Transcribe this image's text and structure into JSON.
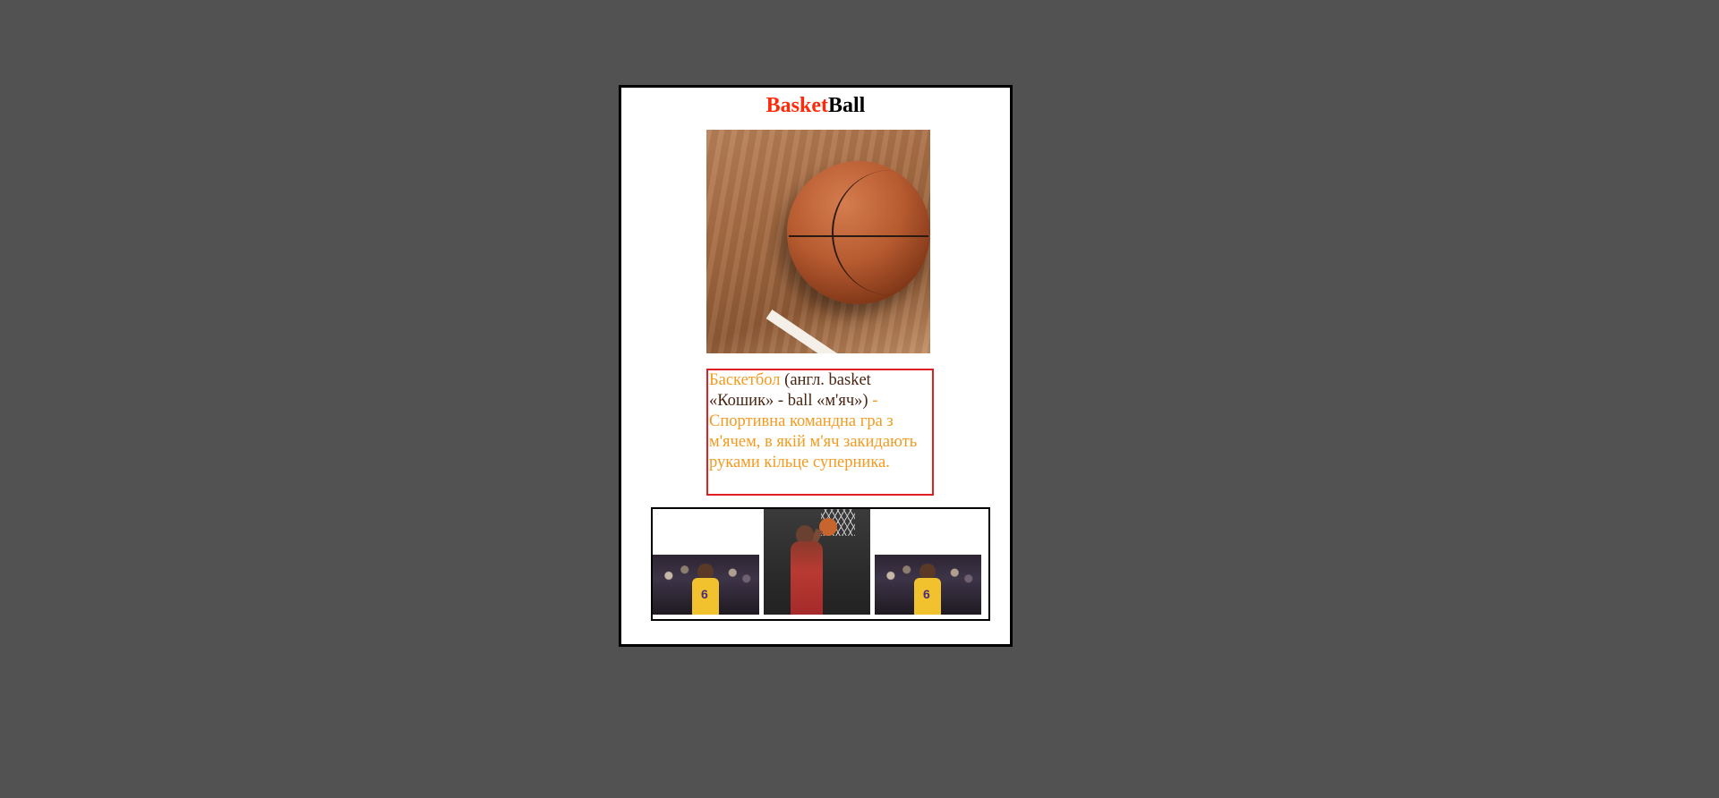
{
  "title": {
    "part1": "Basket",
    "part2": "Ball",
    "colors": {
      "part1": "#ff2a0a",
      "part2": "#000000"
    }
  },
  "main_image": {
    "icon": "basketball-photo"
  },
  "description": {
    "highlight_word": "Баскетбол",
    "etymology": "(англ. basket «Кошик» - ball «м'яч»)",
    "rest": " - Спортивна командна гра з м'ячем, в якій м'яч закидають руками кільце суперника.",
    "colors": {
      "text": "#f39a1f",
      "etymology": "#4a2512",
      "border": "#e02020"
    }
  },
  "gallery": {
    "images": [
      {
        "icon": "lakers-player-photo"
      },
      {
        "icon": "nuggets-player-dunk-photo"
      },
      {
        "icon": "lakers-player-photo"
      }
    ]
  }
}
